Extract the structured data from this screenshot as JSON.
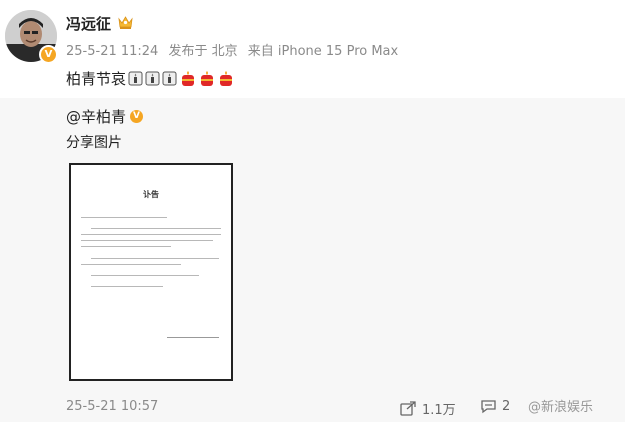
{
  "post": {
    "username": "冯远征",
    "meta": {
      "time": "25-5-21 11:24",
      "location": "发布于 北京",
      "device": "来自 iPhone 15 Pro Max"
    },
    "text": "柏青节哀"
  },
  "repost": {
    "original_user": "@辛柏青",
    "text": "分享图片",
    "document": {
      "title": "讣告"
    },
    "date": "25-5-21 10:57",
    "actions": {
      "share_count": "1.1万",
      "comment_count": "2",
      "watermark": "@新浪娱乐"
    }
  },
  "colors": {
    "badge": "#f5a623",
    "repost_bg": "#f7f7f7",
    "meta_text": "#8a8a8a"
  }
}
